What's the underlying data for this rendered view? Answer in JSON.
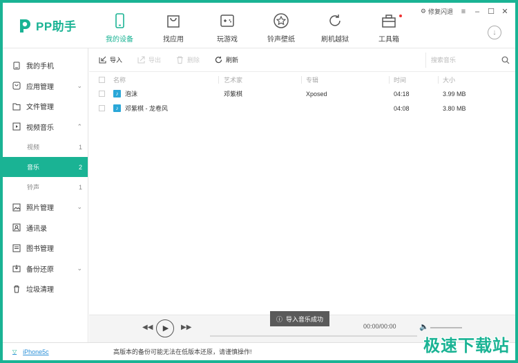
{
  "app": {
    "logo_text": "PP助手",
    "brand_color": "#1ab394"
  },
  "window_controls": {
    "repair_label": "修复闪退"
  },
  "nav": [
    {
      "label": "我的设备",
      "icon": "phone-icon",
      "active": true
    },
    {
      "label": "找应用",
      "icon": "bag-icon",
      "active": false
    },
    {
      "label": "玩游戏",
      "icon": "gamepad-icon",
      "active": false
    },
    {
      "label": "铃声壁纸",
      "icon": "star-icon",
      "active": false
    },
    {
      "label": "刷机越狱",
      "icon": "refresh-icon",
      "active": false
    },
    {
      "label": "工具箱",
      "icon": "toolbox-icon",
      "active": false
    }
  ],
  "sidebar": {
    "items": [
      {
        "label": "我的手机",
        "icon": "phone-icon"
      },
      {
        "label": "应用管理",
        "icon": "app-icon"
      },
      {
        "label": "文件管理",
        "icon": "folder-icon"
      },
      {
        "label": "视频音乐",
        "icon": "video-icon"
      },
      {
        "label": "照片管理",
        "icon": "photo-icon"
      },
      {
        "label": "通讯录",
        "icon": "contacts-icon"
      },
      {
        "label": "图书管理",
        "icon": "book-icon"
      },
      {
        "label": "备份还原",
        "icon": "backup-icon"
      },
      {
        "label": "垃圾清理",
        "icon": "trash-icon"
      }
    ],
    "sub_items": [
      {
        "label": "视频",
        "count": "1"
      },
      {
        "label": "音乐",
        "count": "2"
      },
      {
        "label": "铃声",
        "count": "1"
      }
    ]
  },
  "toolbar": {
    "import_label": "导入",
    "export_label": "导出",
    "delete_label": "删除",
    "refresh_label": "刷新",
    "search_placeholder": "搜索音乐"
  },
  "table": {
    "headers": {
      "name": "名称",
      "artist": "艺术家",
      "album": "专辑",
      "time": "时间",
      "size": "大小"
    },
    "rows": [
      {
        "name": "泡沫",
        "artist": "邓紫棋",
        "album": "Xposed",
        "time": "04:18",
        "size": "3.99 MB"
      },
      {
        "name": "邓紫棋 - 龙卷风",
        "artist": "",
        "album": "",
        "time": "04:08",
        "size": "3.80 MB"
      }
    ]
  },
  "player": {
    "time": "00:00/00:00",
    "toast": "导入音乐成功"
  },
  "statusbar": {
    "device": "iPhone5c",
    "notice": "高版本的备份可能无法在低版本还原，请谨慎操作!",
    "watermark": "极速下载站"
  }
}
